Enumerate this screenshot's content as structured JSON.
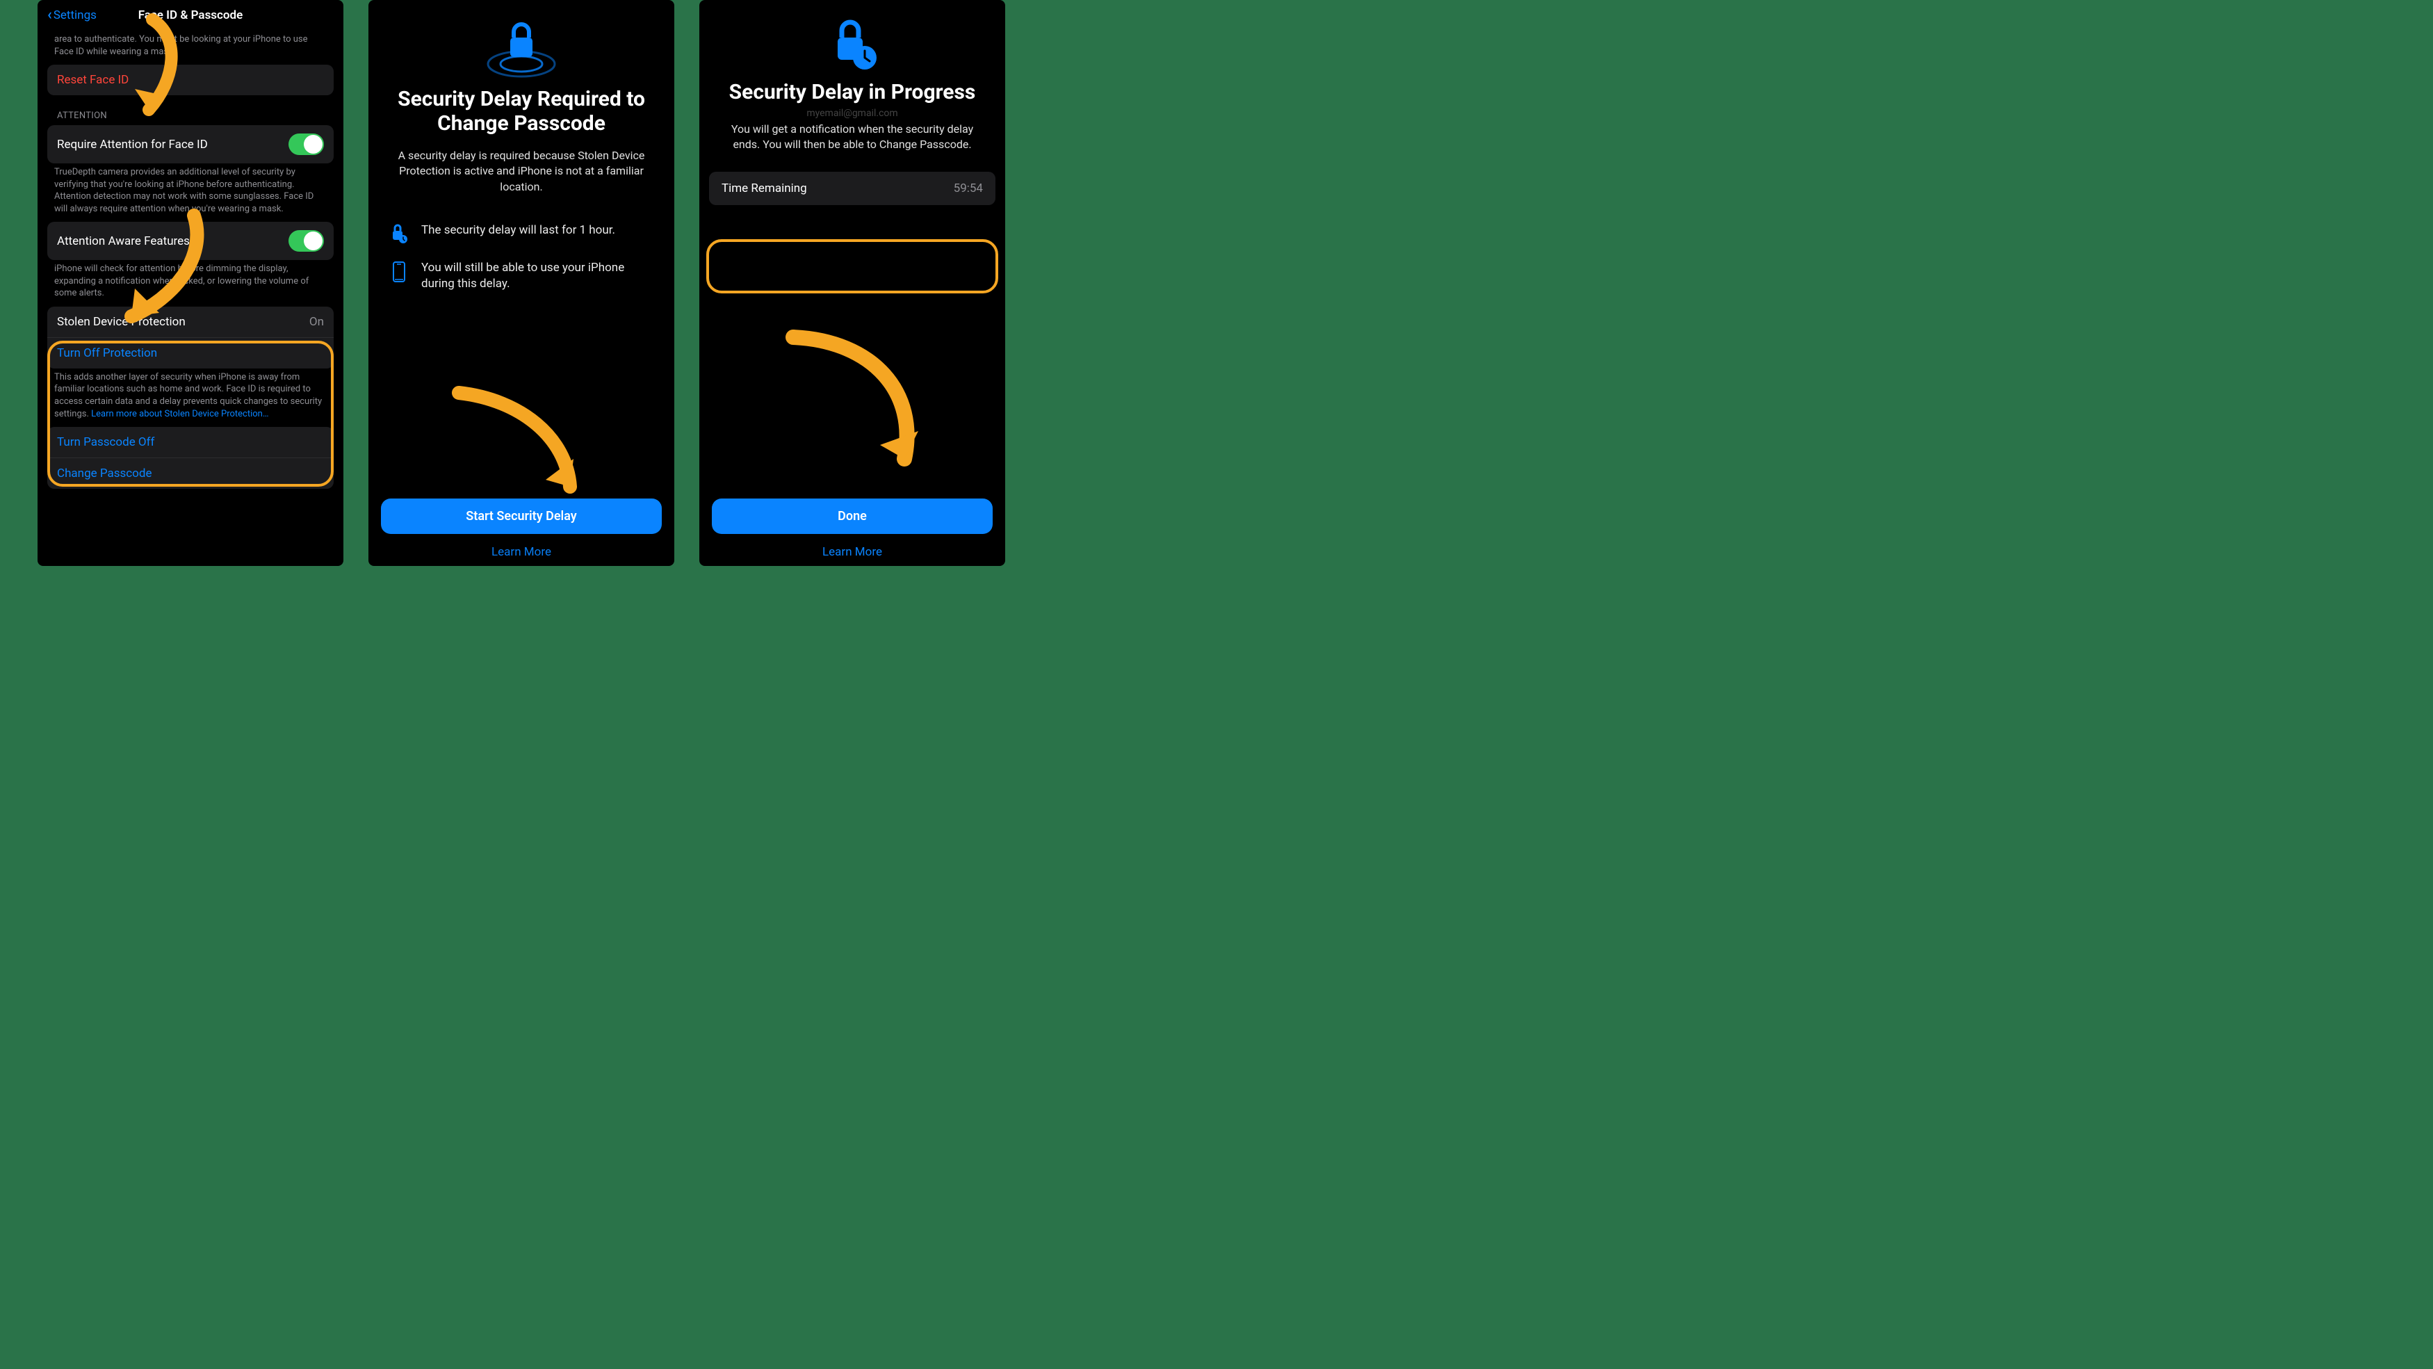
{
  "screen1": {
    "back_label": "Settings",
    "title": "Face ID & Passcode",
    "intro_fragment": "area to authenticate. You must be looking at your iPhone to use Face ID while wearing a mask.",
    "reset_face_id": "Reset Face ID",
    "attention_header": "ATTENTION",
    "require_attention_label": "Require Attention for Face ID",
    "require_attention_desc": "TrueDepth camera provides an additional level of security by verifying that you're looking at iPhone before authenticating. Attention detection may not work with some sunglasses. Face ID will always require attention when you're wearing a mask.",
    "attention_aware_label": "Attention Aware Features",
    "attention_aware_desc": "iPhone will check for attention before dimming the display, expanding a notification when locked, or lowering the volume of some alerts.",
    "sdp_label": "Stolen Device Protection",
    "sdp_value": "On",
    "sdp_turn_off": "Turn Off Protection",
    "sdp_desc": "This adds another layer of security when iPhone is away from familiar locations such as home and work. Face ID is required to access certain data and a delay prevents quick changes to security settings. ",
    "sdp_link": "Learn more about Stolen Device Protection…",
    "turn_passcode_off": "Turn Passcode Off",
    "change_passcode": "Change Passcode"
  },
  "screen2": {
    "title": "Security Delay Required to Change Passcode",
    "subtitle": "A security delay is required because Stolen Device Protection is active and iPhone is not at a familiar location.",
    "row1": "The security delay will last for 1 hour.",
    "row2": "You will still be able to use your iPhone during this delay.",
    "button": "Start Security Delay",
    "learn_more": "Learn More"
  },
  "screen3": {
    "title": "Security Delay in Progress",
    "faint_email": "myemail@gmail.com",
    "subtitle": "You will get a notification when the security delay ends. You will then be able to Change Passcode.",
    "time_label": "Time Remaining",
    "time_value": "59:54",
    "button": "Done",
    "learn_more": "Learn More"
  },
  "colors": {
    "accent_blue": "#0a84ff",
    "orange": "#f5a623",
    "green_toggle": "#34c759",
    "red": "#ff453a"
  }
}
